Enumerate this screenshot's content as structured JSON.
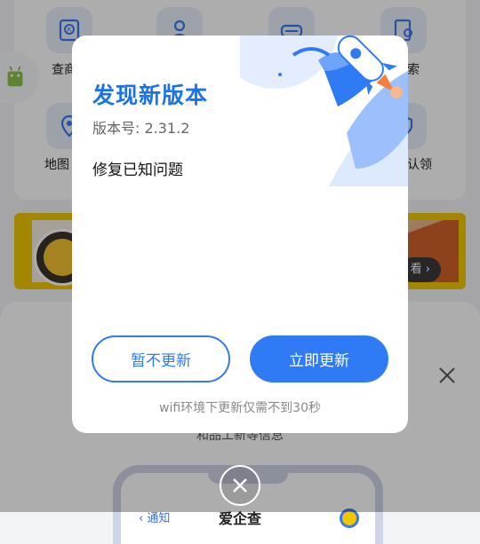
{
  "background": {
    "grid_labels": {
      "query": "查商",
      "search": "搜索",
      "map": "地图",
      "claim": "认领"
    },
    "banner_button": "看 ›",
    "sheet_text": "和品工新等信息",
    "phone": {
      "back": "‹ 通知",
      "title": "爱企查"
    }
  },
  "dialog": {
    "title": "发现新版本",
    "version": "版本号: 2.31.2",
    "notes": "修复已知问题",
    "later_button": "暂不更新",
    "update_button": "立即更新",
    "hint": "wifi环境下更新仅需不到30秒"
  },
  "colors": {
    "accent": "#2f7af5",
    "title": "#1a73e8"
  },
  "icons": {
    "dismiss": "close-circle-icon",
    "rocket": "rocket-illustration"
  }
}
